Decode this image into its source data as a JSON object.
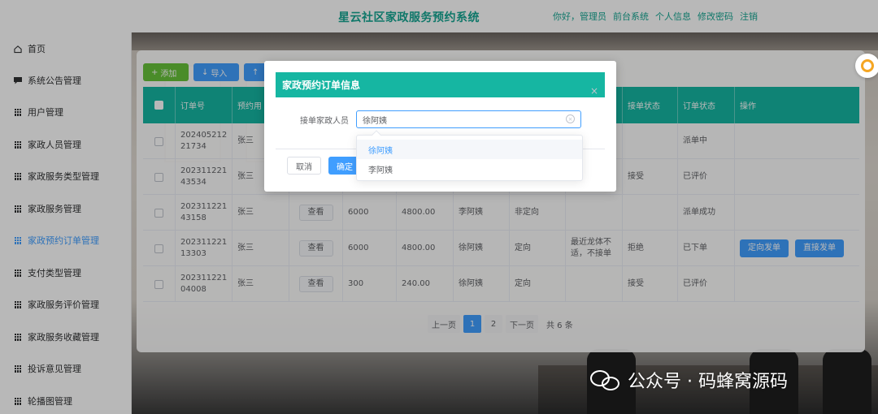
{
  "header": {
    "title": "星云社区家政服务预约系统",
    "links": [
      "你好，管理员",
      "前台系统",
      "个人信息",
      "修改密码",
      "注销"
    ]
  },
  "sidebar": {
    "items": [
      {
        "label": "首页",
        "icon": "home-icon"
      },
      {
        "label": "系统公告管理",
        "icon": "message-icon"
      },
      {
        "label": "用户管理",
        "icon": "grid-icon"
      },
      {
        "label": "家政人员管理",
        "icon": "grid-icon"
      },
      {
        "label": "家政服务类型管理",
        "icon": "grid-icon"
      },
      {
        "label": "家政服务管理",
        "icon": "grid-icon"
      },
      {
        "label": "家政预约订单管理",
        "icon": "grid-icon",
        "active": true
      },
      {
        "label": "支付类型管理",
        "icon": "grid-icon"
      },
      {
        "label": "家政服务评价管理",
        "icon": "grid-icon"
      },
      {
        "label": "家政服务收藏管理",
        "icon": "grid-icon"
      },
      {
        "label": "投诉意见管理",
        "icon": "grid-icon"
      },
      {
        "label": "轮播图管理",
        "icon": "grid-icon"
      }
    ]
  },
  "toolbar": {
    "add": "添加",
    "import": "导入"
  },
  "table": {
    "headers": [
      "订单号",
      "预约用",
      "",
      "",
      "",
      "",
      "",
      "接单状态",
      "订单状态",
      "操作"
    ],
    "view_label": "查看",
    "rows": [
      {
        "order": "20240521221734",
        "user": "张三",
        "view": false,
        "price": "",
        "paid": "",
        "staff": "",
        "type": "",
        "remark": "",
        "accept": "",
        "status": "派单中",
        "ops": []
      },
      {
        "order": "20231122143534",
        "user": "张三",
        "view": false,
        "price": "",
        "paid": "",
        "staff": "",
        "type": "",
        "remark": "",
        "accept": "接受",
        "status": "已评价",
        "ops": []
      },
      {
        "order": "20231122143158",
        "user": "张三",
        "view": true,
        "price": "6000",
        "paid": "4800.00",
        "staff": "李阿姨",
        "type": "非定向",
        "remark": "",
        "accept": "",
        "status": "派单成功",
        "ops": []
      },
      {
        "order": "20231122113303",
        "user": "张三",
        "view": true,
        "price": "6000",
        "paid": "4800.00",
        "staff": "徐阿姨",
        "type": "定向",
        "remark": "最近龙体不适，不接单",
        "accept": "拒绝",
        "status": "已下单",
        "ops": [
          "定向发单",
          "直接发单"
        ]
      },
      {
        "order": "20231122104008",
        "user": "张三",
        "view": true,
        "price": "300",
        "paid": "240.00",
        "staff": "徐阿姨",
        "type": "定向",
        "remark": "",
        "accept": "接受",
        "status": "已评价",
        "ops": []
      }
    ]
  },
  "pager": {
    "prev": "上一页",
    "pages": [
      "1",
      "2"
    ],
    "current": "1",
    "next": "下一页",
    "total": "共 6 条"
  },
  "dialog": {
    "title": "家政预约订单信息",
    "field_label": "接单家政人员",
    "field_value": "徐阿姨",
    "cancel": "取消",
    "confirm": "确定",
    "options": [
      "徐阿姨",
      "李阿姨"
    ],
    "selected_option": "徐阿姨"
  },
  "watermark": {
    "text": "公众号 · 码蜂窝源码"
  },
  "colors": {
    "teal": "#16b6a2",
    "primary": "#409eff",
    "green": "#67c23a"
  }
}
